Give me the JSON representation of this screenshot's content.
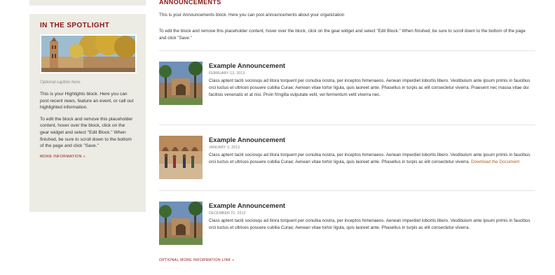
{
  "sidebar": {
    "spotlight_title": "IN THE SPOTLIGHT",
    "caption": "Optional caption here.",
    "paragraph1": "This is your Highlights block. Here you can post recent news, feature an event, or call out highlighted information.",
    "paragraph2": "To edit the block and remove this placeholder content, hover over the block, click on the gear widget and select \"Edit Block.\" When finished, be sure to scroll down to the bottom of the page and click \"Save.\"",
    "more_link": "MORE INFORMATION »"
  },
  "main": {
    "heading": "ANNOUNCEMENTS",
    "intro1": "This is your Announcements block. Here you can post announcements about your organization",
    "intro2": "To edit the block and remove this placeholder content, hover over the block, click on the gear widget and select \"Edit Block.\" When finished, be sure to scroll down to the bottom of the page and click \"Save.\"",
    "announcements": [
      {
        "title": "Example Announcement",
        "date": "FEBRUARY 13, 2013",
        "text": "Class aptent taciti sociosqu ad litora torquent per conubia nostra, per inceptos himenaeos. Aenean imperdiet lobortis libero. Vestibulum ante ipsum primis in faucibus orci luctus et ultrices posuere cubilia Curae; Aenean vitae tortor ligula, quis laoreet ante. Phasellus in turpis ac elit consectetur viverra. Praesent nec massa vitae dui facilisis venenatis et at nisi. Proin fringilla vulputate velit, vel fermentum velit viverra nec."
      },
      {
        "title": "Example Announcement",
        "date": "JANUARY 3, 2013",
        "text": "Class aptent taciti sociosqu ad litora torquent per conubia nostra, per inceptos himenaeos. Aenean imperdiet lobortis libero. Vestibulum ante ipsum primis in faucibus orci luctus et ultrices posuere cubilia Curae; Aenean vitae tortor ligula, quis laoreet ante. Phasellus in turpis ac elit consectetur viverra.",
        "link": "Download the Document"
      },
      {
        "title": "Example Announcement",
        "date": "DECEMBER 21, 2012",
        "text": "Class aptent taciti sociosqu ad litora torquent per conubia nostra, per inceptos himenaeos. Aenean imperdiet lobortis libero. Vestibulum ante ipsum primis in faucibus orci luctus et ultrices posuere cubilia Curae; Aenean vitae tortor ligula, quis laoreet ante. Phasellus in turpis ac elit consectetur viverra."
      }
    ],
    "optional_link": "OPTIONAL MORE INFORMATION LINK »"
  },
  "colors": {
    "accent": "#8c1515",
    "sidebar_bg": "#ecebe4",
    "link_brown": "#a0632a"
  }
}
